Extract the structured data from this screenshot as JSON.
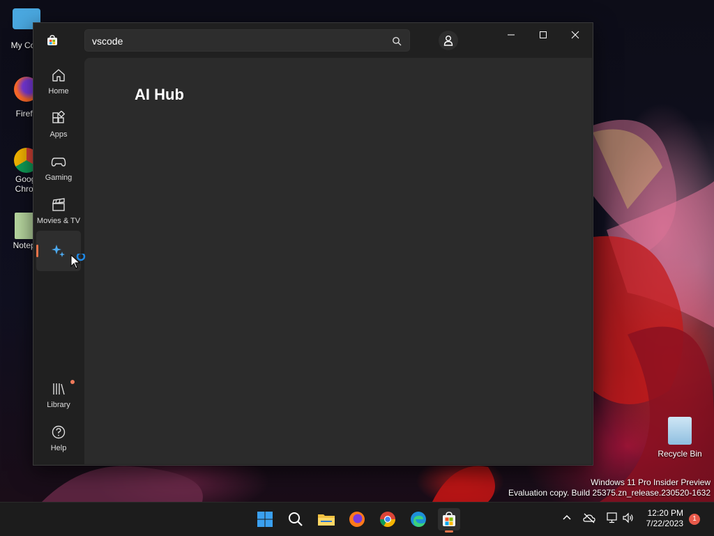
{
  "desktop": {
    "icons": [
      {
        "label": "My Com"
      },
      {
        "label": "Firefo"
      },
      {
        "label": "Googl Chron"
      },
      {
        "label": "Notepa"
      },
      {
        "label": "Recycle Bin"
      }
    ],
    "watermark": {
      "line1": "Windows 11 Pro Insider Preview",
      "line2": "Evaluation copy. Build 25375.zn_release.230520-1632"
    }
  },
  "window": {
    "search": {
      "value": "vscode"
    },
    "nav": [
      {
        "label": "Home",
        "icon": "home-icon"
      },
      {
        "label": "Apps",
        "icon": "apps-icon"
      },
      {
        "label": "Gaming",
        "icon": "gamepad-icon"
      },
      {
        "label": "Movies & TV",
        "icon": "clapperboard-icon"
      },
      {
        "label": "",
        "icon": "sparkle-icon",
        "active": true
      },
      {
        "label": "Library",
        "icon": "library-icon",
        "badge": true
      },
      {
        "label": "Help",
        "icon": "help-icon"
      }
    ],
    "page_title": "AI Hub"
  },
  "taskbar": {
    "clock": {
      "time": "12:20 PM",
      "date": "7/22/2023"
    },
    "notifications": "1",
    "accent": "#e8734a"
  }
}
